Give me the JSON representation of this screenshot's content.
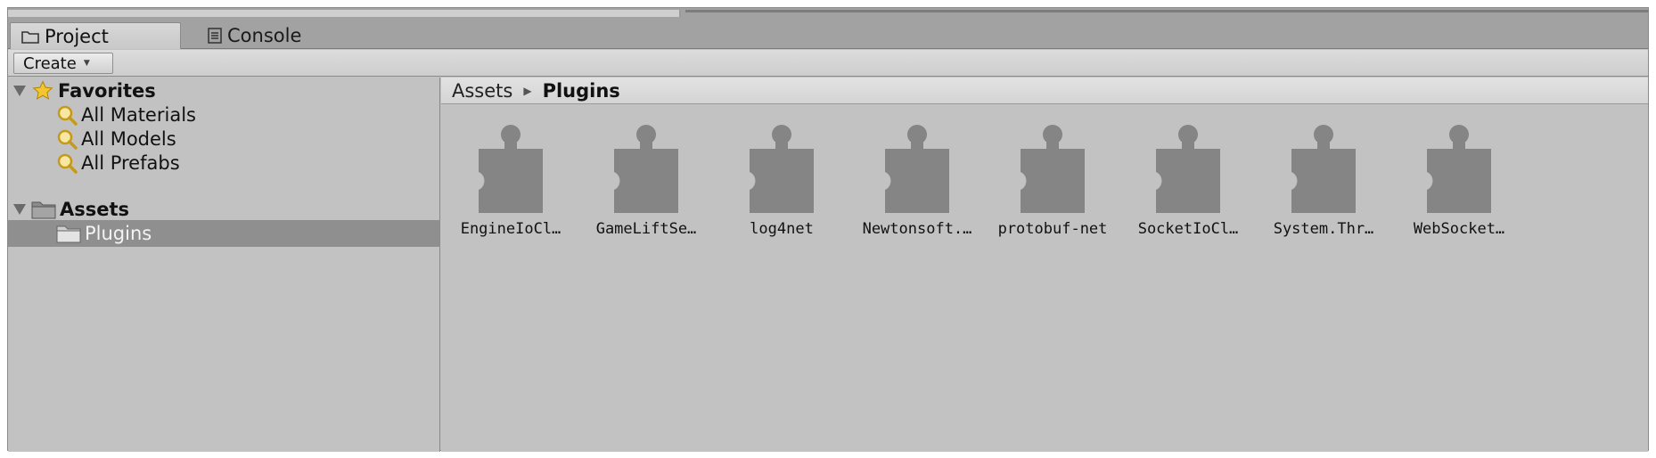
{
  "tabs": [
    {
      "label": "Project",
      "icon": "folder-icon",
      "active": true
    },
    {
      "label": "Console",
      "icon": "console-icon",
      "active": false
    }
  ],
  "toolbar": {
    "create_label": "Create",
    "create_arrow": "▼"
  },
  "sidebar": {
    "favorites": {
      "label": "Favorites",
      "items": [
        {
          "label": "All Materials",
          "icon": "search-icon"
        },
        {
          "label": "All Models",
          "icon": "search-icon"
        },
        {
          "label": "All Prefabs",
          "icon": "search-icon"
        }
      ]
    },
    "assets": {
      "label": "Assets",
      "items": [
        {
          "label": "Plugins",
          "icon": "folder-icon",
          "selected": true
        }
      ]
    }
  },
  "breadcrumb": {
    "root": "Assets",
    "separator": "▶",
    "current": "Plugins"
  },
  "files": [
    {
      "label": "EngineIoCl…",
      "icon": "puzzle-icon"
    },
    {
      "label": "GameLiftSe…",
      "icon": "puzzle-icon"
    },
    {
      "label": "log4net",
      "icon": "puzzle-icon"
    },
    {
      "label": "Newtonsoft.…",
      "icon": "puzzle-icon"
    },
    {
      "label": "protobuf-net",
      "icon": "puzzle-icon"
    },
    {
      "label": "SocketIoCl…",
      "icon": "puzzle-icon"
    },
    {
      "label": "System.Thr…",
      "icon": "puzzle-icon"
    },
    {
      "label": "WebSocket…",
      "icon": "puzzle-icon"
    }
  ],
  "colors": {
    "panel": "#c2c2c2",
    "selected": "#8f8f8f",
    "icon": "#858585"
  }
}
